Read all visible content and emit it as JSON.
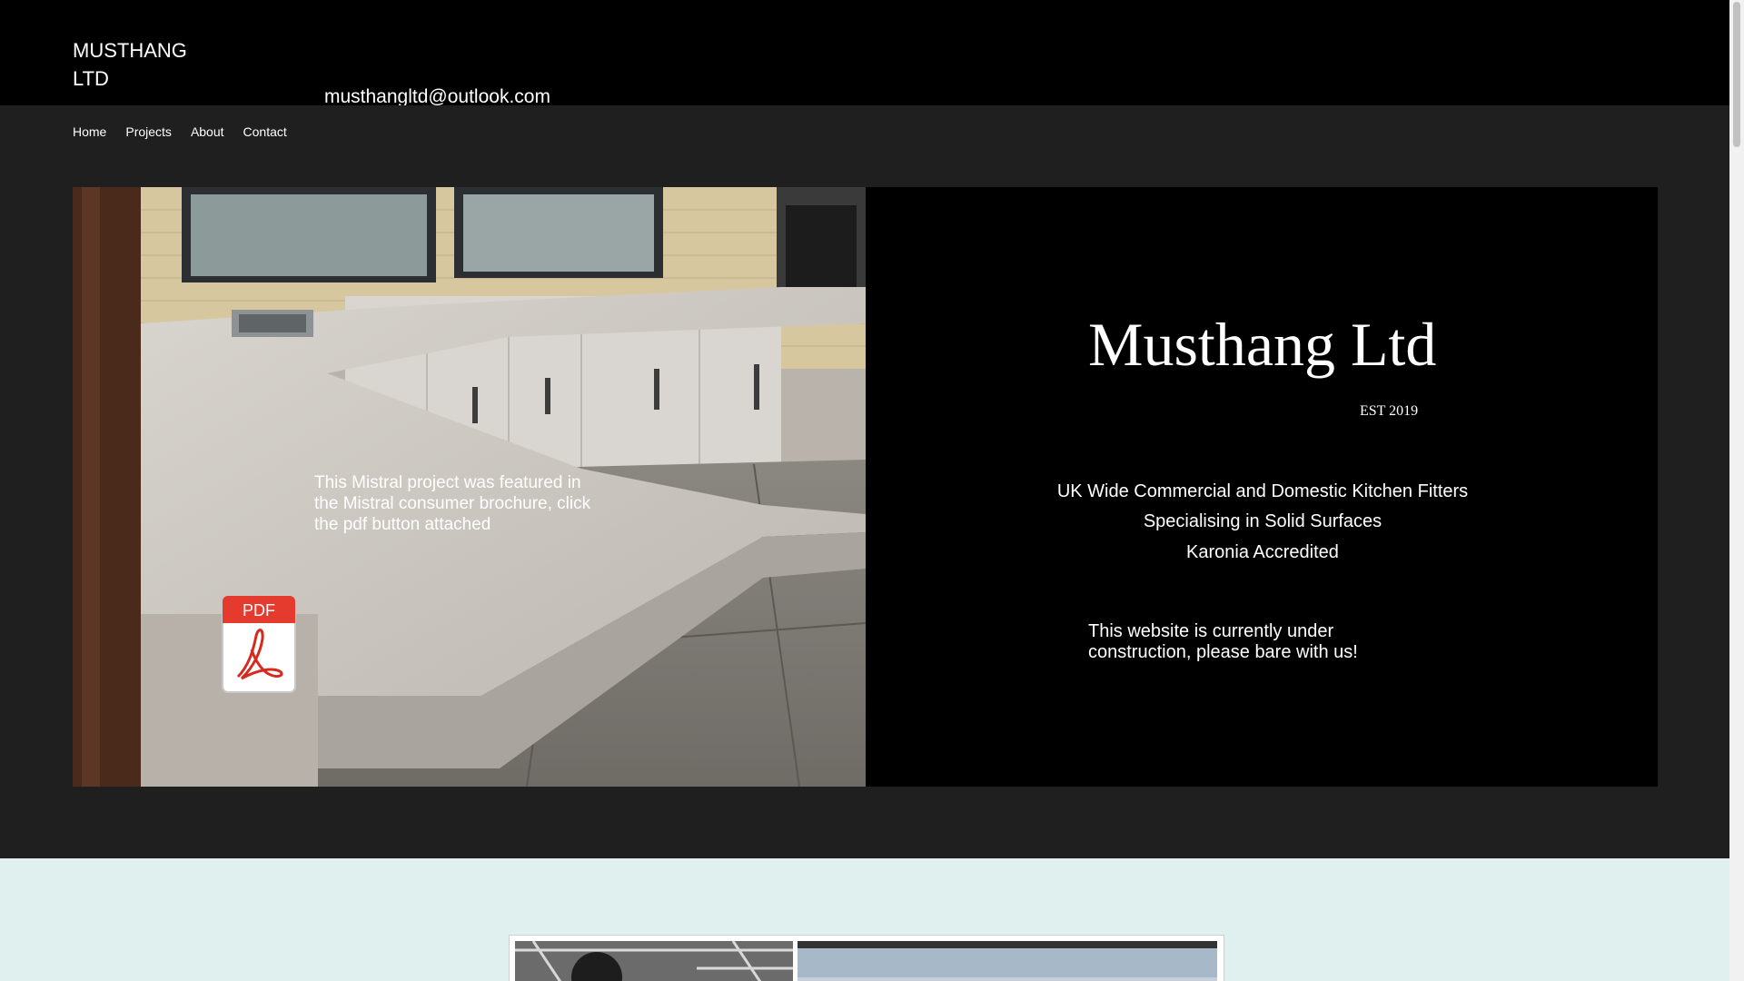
{
  "header": {
    "logo": "MUSTHANG LTD",
    "email": "musthangltd@outlook.com"
  },
  "nav": {
    "items": [
      "Home",
      "Projects",
      "About",
      "Contact"
    ]
  },
  "hero": {
    "featured_text": "This Mistral project was featured in the Mistral consumer brochure, click the pdf button attached",
    "pdf_label": "PDF",
    "brand_title": "Musthang Ltd",
    "est": "EST 2019",
    "taglines": [
      "UK Wide Commercial and Domestic Kitchen Fitters",
      "Specialising in Solid Surfaces",
      "Karonia Accredited"
    ],
    "notice": "This website is currently under construction, please bare with us!"
  },
  "colors": {
    "header_bg": "#000000",
    "nav_band": "#1f1f1f",
    "light_section": "#dff0ef",
    "pdf_red": "#e53b2f"
  }
}
